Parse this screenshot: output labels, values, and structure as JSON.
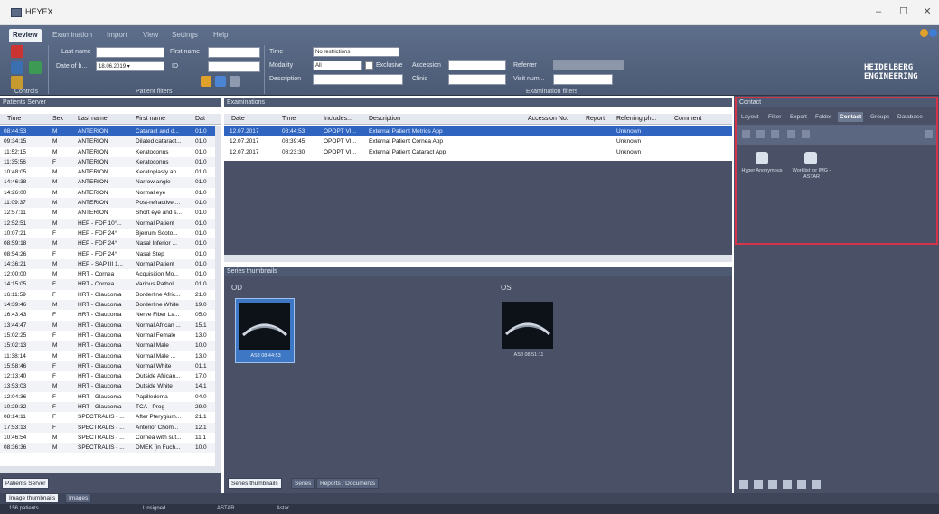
{
  "window": {
    "title": "HEYEX",
    "min": "–",
    "max": "☐",
    "close": "✕"
  },
  "menu": {
    "tabs": [
      "Review",
      "Examination",
      "Import",
      "View",
      "Settings",
      "Help"
    ]
  },
  "patient_filters": {
    "last_name_label": "Last name",
    "first_name_label": "First name",
    "dob_label": "Date of b...",
    "dob_value": "18.06.2019",
    "id_label": "ID",
    "caption": "Patient filters",
    "controls_caption": "Controls"
  },
  "exam_filters": {
    "time_label": "Time",
    "time_value": "No restrictions",
    "modality_label": "Modality",
    "modality_value": "All",
    "exclusive_label": "Exclusive",
    "accession_label": "Accession",
    "description_label": "Description",
    "clinic_label": "Clinic",
    "referrer_label": "Referrer",
    "visit_label": "Visit num...",
    "caption": "Examination filters"
  },
  "brand": {
    "line1": "HEIDELBERG",
    "line2": "ENGINEERING"
  },
  "patients": {
    "title": "Patients Server",
    "columns": [
      "Time",
      "Sex",
      "Last name",
      "First name",
      "Dat"
    ],
    "rows": [
      [
        "08:44:53",
        "M",
        "ANTERION",
        "Cataract and d...",
        "01.0"
      ],
      [
        "09:34:15",
        "M",
        "ANTERION",
        "Dilated cataract...",
        "01.0"
      ],
      [
        "11:52:15",
        "M",
        "ANTERION",
        "Keratoconus",
        "01.0"
      ],
      [
        "11:35:56",
        "F",
        "ANTERION",
        "Keratoconus",
        "01.0"
      ],
      [
        "10:48:05",
        "M",
        "ANTERION",
        "Keratoplasty an...",
        "01.0"
      ],
      [
        "14:46:38",
        "M",
        "ANTERION",
        "Narrow angle",
        "01.0"
      ],
      [
        "14:26:00",
        "M",
        "ANTERION",
        "Normal eye",
        "01.0"
      ],
      [
        "11:09:37",
        "M",
        "ANTERION",
        "Post-refractive ...",
        "01.0"
      ],
      [
        "12:57:11",
        "M",
        "ANTERION",
        "Short eye and s...",
        "01.0"
      ],
      [
        "12:52:51",
        "M",
        "HEP - FDF 10°...",
        "Normal Patient",
        "01.0"
      ],
      [
        "10:07:21",
        "F",
        "HEP - FDF 24°",
        "Bjerrum Scoto...",
        "01.0"
      ],
      [
        "08:59:18",
        "M",
        "HEP - FDF 24°",
        "Nasal Inferior ...",
        "01.0"
      ],
      [
        "08:54:26",
        "F",
        "HEP - FDF 24°",
        "Nasal Step",
        "01.0"
      ],
      [
        "14:36:21",
        "M",
        "HEP - SAP III 1...",
        "Normal Patient",
        "01.0"
      ],
      [
        "12:00:00",
        "M",
        "HRT - Cornea",
        "Acquisition Mo...",
        "01.0"
      ],
      [
        "14:15:05",
        "F",
        "HRT - Cornea",
        "Various Pathol...",
        "01.0"
      ],
      [
        "16:11:59",
        "F",
        "HRT - Glaucoma",
        "Borderline Afric...",
        "21.0"
      ],
      [
        "14:39:46",
        "M",
        "HRT - Glaucoma",
        "Borderline White",
        "19.0"
      ],
      [
        "16:43:43",
        "F",
        "HRT - Glaucoma",
        "Nerve Fiber La...",
        "05.0"
      ],
      [
        "13:44:47",
        "M",
        "HRT - Glaucoma",
        "Normal African ...",
        "15.1"
      ],
      [
        "15:02:25",
        "F",
        "HRT - Glaucoma",
        "Normal Female",
        "13.0"
      ],
      [
        "15:02:13",
        "M",
        "HRT - Glaucoma",
        "Normal Male",
        "10.0"
      ],
      [
        "11:38:14",
        "M",
        "HRT - Glaucoma",
        "Normal Male ...",
        "13.0"
      ],
      [
        "15:58:46",
        "F",
        "HRT - Glaucoma",
        "Normal White",
        "01.1"
      ],
      [
        "12:13:40",
        "F",
        "HRT - Glaucoma",
        "Outside African...",
        "17.0"
      ],
      [
        "13:53:03",
        "M",
        "HRT - Glaucoma",
        "Outside White",
        "14.1"
      ],
      [
        "12:04:36",
        "F",
        "HRT - Glaucoma",
        "Papilledema",
        "04.0"
      ],
      [
        "10:29:32",
        "F",
        "HRT - Glaucoma",
        "TCA - Prog",
        "29.0"
      ],
      [
        "08:14:11",
        "F",
        "SPECTRALIS - ...",
        "After Pterygium...",
        "21.1"
      ],
      [
        "17:53:13",
        "F",
        "SPECTRALIS - ...",
        "Anterior Chom...",
        "12.1"
      ],
      [
        "10:46:54",
        "M",
        "SPECTRALIS - ...",
        "Cornea with sut...",
        "11.1"
      ],
      [
        "08:36:36",
        "M",
        "SPECTRALIS - ...",
        "DMEK (in Fuch...",
        "10.0"
      ]
    ],
    "bottom_tab": "Patients Server"
  },
  "examinations": {
    "title": "Examinations",
    "columns": [
      "Date",
      "Time",
      "Includes...",
      "Description",
      "Accession No.",
      "Report",
      "Referring ph...",
      "Comment"
    ],
    "rows": [
      [
        "12.07.2017",
        "08:44:53",
        "OPOPT VI...",
        "External Patient Metrics App",
        "",
        "",
        "Unknown",
        ""
      ],
      [
        "12.07.2017",
        "08:39:45",
        "OPOPT VI...",
        "External Patient Cornea App",
        "",
        "",
        "Unknown",
        ""
      ],
      [
        "12.07.2017",
        "08:23:30",
        "OPOPT VI...",
        "External Patient Cataract App",
        "",
        "",
        "Unknown",
        ""
      ]
    ]
  },
  "thumbnails": {
    "title": "Series thumbnails",
    "od": {
      "label": "OD",
      "caption": "AS8 08:44:53"
    },
    "os": {
      "label": "OS",
      "caption": "AS8 08:51:11"
    },
    "tabs": [
      "Series thumbnails",
      "Series",
      "Reports / Documents"
    ]
  },
  "contact": {
    "title": "Contact",
    "tabs": [
      "Layout",
      "Filter",
      "Export",
      "Folder",
      "Contact",
      "Groups",
      "Database"
    ],
    "items": [
      {
        "label": "Hyper Anonymous"
      },
      {
        "label": "Worklist for IMG - ASTAR"
      }
    ]
  },
  "bottom_tabs": [
    "Image thumbnails",
    "Images"
  ],
  "status": {
    "items": [
      "156 patients",
      "Unsigned",
      "ASTAR",
      "Astar"
    ]
  }
}
